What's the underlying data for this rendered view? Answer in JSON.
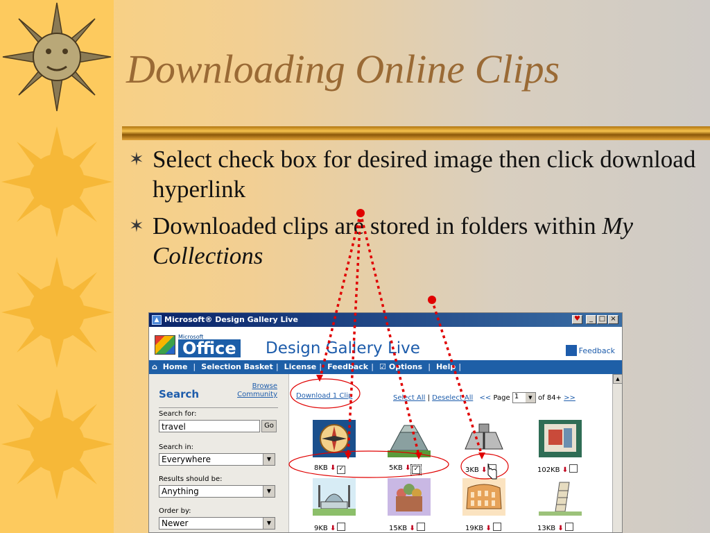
{
  "slide": {
    "title": "Downloading Online Clips",
    "bullets": [
      {
        "text": "Select check box for desired image then click download hyperlink"
      },
      {
        "text": "Downloaded clips are stored in folders within ",
        "italic": "My Collections"
      }
    ]
  },
  "window": {
    "title": "Microsoft® Design Gallery Live",
    "logo_small": "Microsoft",
    "logo_office": "Office",
    "site_title": "Design Gallery Live",
    "feedback": "Feedback",
    "nav": [
      "Home",
      "Selection Basket",
      "License",
      "Feedback",
      "Options",
      "Help"
    ],
    "sidebar": {
      "search_heading": "Search",
      "browse_link": "Browse Community",
      "search_for_label": "Search for:",
      "search_for_value": "travel",
      "go_label": "Go",
      "search_in_label": "Search in:",
      "search_in_value": "Everywhere",
      "results_label": "Results should be:",
      "results_value": "Anything",
      "order_label": "Order by:",
      "order_value": "Newer"
    },
    "main": {
      "download_link": "Download 1 Clip",
      "select_all": "Select All",
      "deselect_all": "Deselect All",
      "prev": "<<",
      "page_label": "Page",
      "page_value": "1",
      "page_total": "of 84+",
      "next": ">>",
      "clips": [
        {
          "size": "8KB",
          "checked": true,
          "subject": "compass-clip"
        },
        {
          "size": "5KB",
          "checked": true,
          "subject": "pyramid-clip"
        },
        {
          "size": "3KB",
          "checked": false,
          "subject": "temple-clip"
        },
        {
          "size": "102KB",
          "checked": false,
          "subject": "monument-photo"
        },
        {
          "size": "9KB",
          "checked": false,
          "subject": "mosque-clip"
        },
        {
          "size": "15KB",
          "checked": false,
          "subject": "cathedral-clip"
        },
        {
          "size": "19KB",
          "checked": false,
          "subject": "colosseum-clip"
        },
        {
          "size": "13KB",
          "checked": false,
          "subject": "leaning-tower-clip"
        }
      ]
    }
  },
  "colors": {
    "title": "#9a6a35",
    "accent_blue": "#1d5cab",
    "annotation_red": "#e00000"
  }
}
